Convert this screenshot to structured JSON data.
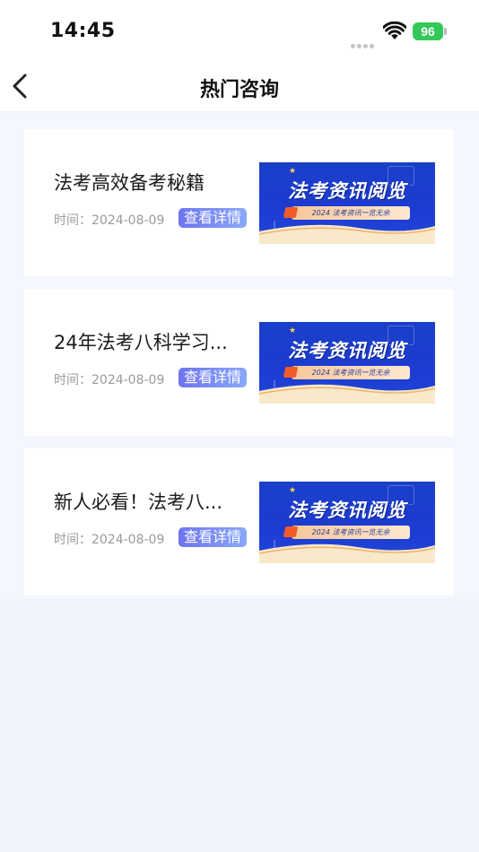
{
  "status_bar": {
    "time": "14:45",
    "battery": "96",
    "icons": [
      "signal-dots-icon",
      "wifi-icon",
      "battery-charging-icon"
    ]
  },
  "nav": {
    "title": "热门咨询",
    "back_icon": "chevron-left-icon"
  },
  "articles": [
    {
      "title": "法考高效备考秘籍",
      "time": "时间：2024-08-09",
      "button": "查看详情",
      "banner": {
        "title": "法考资讯阅览",
        "subtitle": "2024 法考资讯一览无余"
      }
    },
    {
      "title": "24年法考八科学习...",
      "time": "时间：2024-08-09",
      "button": "查看详情",
      "banner": {
        "title": "法考资讯阅览",
        "subtitle": "2024 法考资讯一览无余"
      }
    },
    {
      "title": "新人必看！法考八...",
      "time": "时间：2024-08-09",
      "button": "查看详情",
      "banner": {
        "title": "法考资讯阅览",
        "subtitle": "2024 法考资讯一览无余"
      }
    }
  ],
  "colors": {
    "page_bg": "#eef3fc",
    "banner_blue": "#1d3bd2",
    "button_gradient_start": "#6e74f0",
    "button_gradient_end": "#8aa9f8",
    "battery_green": "#34c759"
  }
}
